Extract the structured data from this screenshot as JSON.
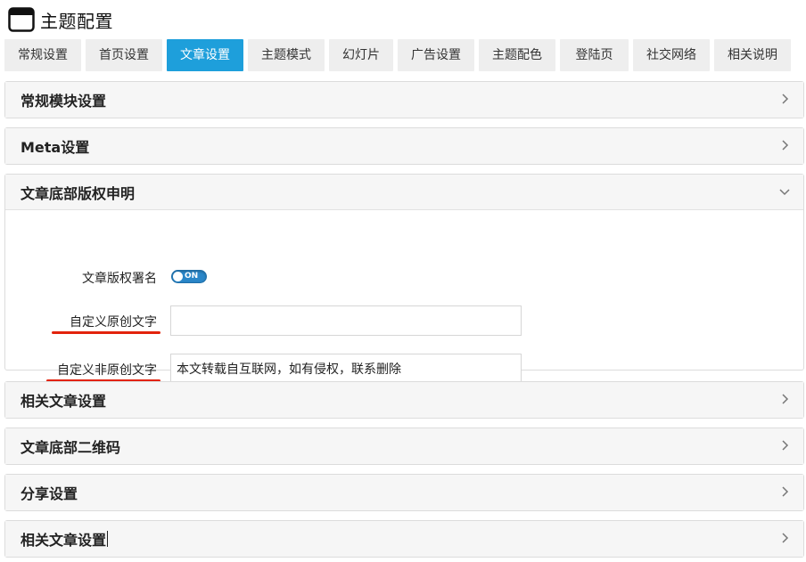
{
  "header": {
    "title": "主题配置",
    "icon": "window-icon"
  },
  "tabs": [
    {
      "label": "常规设置"
    },
    {
      "label": "首页设置"
    },
    {
      "label": "文章设置"
    },
    {
      "label": "主题模式"
    },
    {
      "label": "幻灯片"
    },
    {
      "label": "广告设置"
    },
    {
      "label": "主题配色"
    },
    {
      "label": "登陆页"
    },
    {
      "label": "社交网络"
    },
    {
      "label": "相关说明"
    }
  ],
  "active_tab": "文章设置",
  "sections": [
    {
      "title": "常规模块设置",
      "expanded": false
    },
    {
      "title": "Meta设置",
      "expanded": false
    },
    {
      "title": "文章底部版权申明",
      "expanded": true
    },
    {
      "title": "相关文章设置",
      "expanded": false
    },
    {
      "title": "文章底部二维码",
      "expanded": false
    },
    {
      "title": "分享设置",
      "expanded": false
    },
    {
      "title": "相关文章设置",
      "expanded": false
    }
  ],
  "copyright": {
    "signature_label": "文章版权署名",
    "signature_toggle": "ON",
    "original_label": "自定义原创文字",
    "original_value": "",
    "non_original_label": "自定义非原创文字",
    "non_original_value": "本文转载自互联网，如有侵权，联系删除"
  },
  "colors": {
    "accent": "#1e9fdb",
    "annotation": "#e2230c",
    "toggle": "#2a86c8"
  }
}
